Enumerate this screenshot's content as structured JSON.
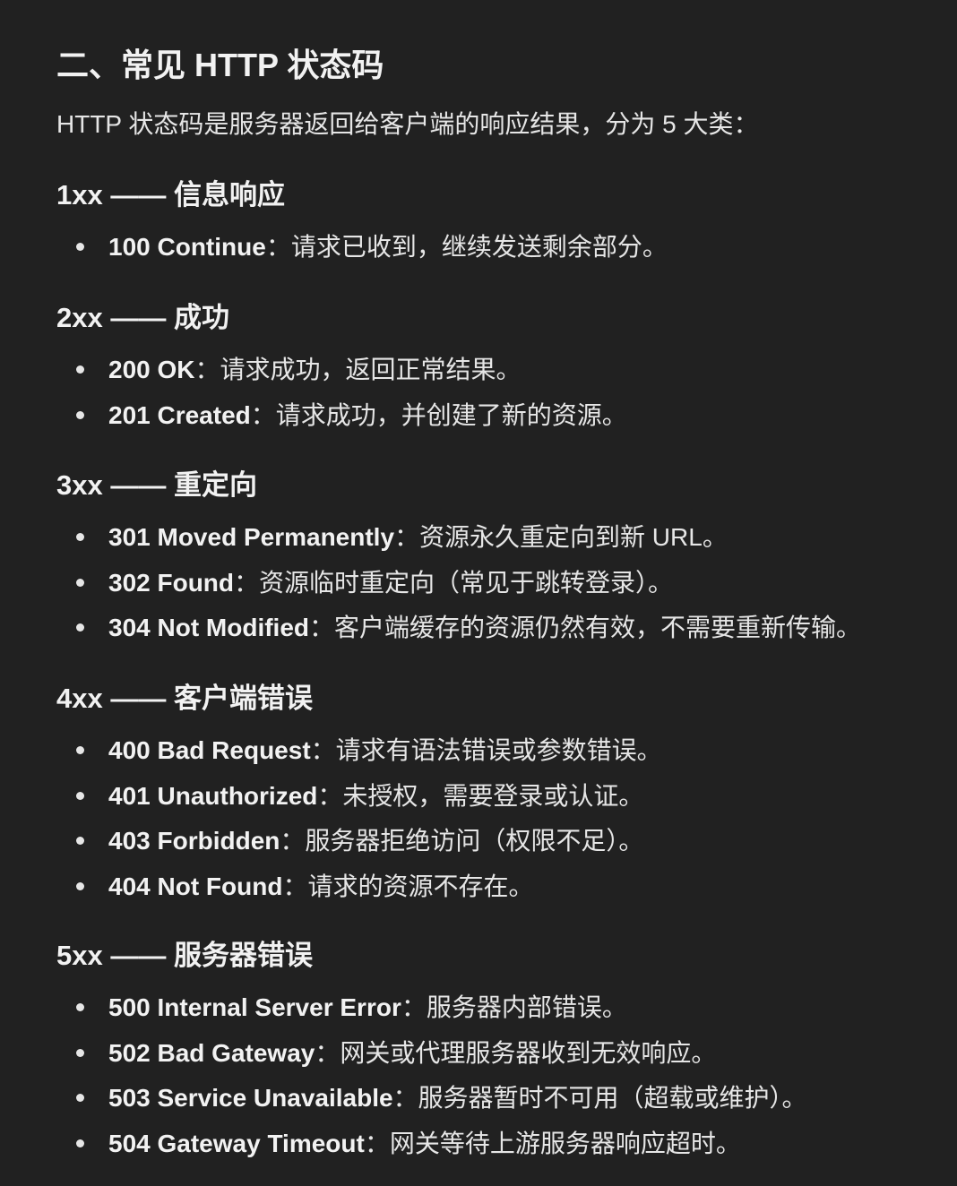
{
  "title": "二、常见 HTTP 状态码",
  "intro": "HTTP 状态码是服务器返回给客户端的响应结果，分为 5 大类：",
  "sections": [
    {
      "heading": "1xx —— 信息响应",
      "items": [
        {
          "code": "100 Continue",
          "desc": "：请求已收到，继续发送剩余部分。"
        }
      ]
    },
    {
      "heading": "2xx —— 成功",
      "items": [
        {
          "code": "200 OK",
          "desc": "：请求成功，返回正常结果。"
        },
        {
          "code": "201 Created",
          "desc": "：请求成功，并创建了新的资源。"
        }
      ]
    },
    {
      "heading": "3xx —— 重定向",
      "items": [
        {
          "code": "301 Moved Permanently",
          "desc": "：资源永久重定向到新 URL。"
        },
        {
          "code": "302 Found",
          "desc": "：资源临时重定向（常见于跳转登录）。"
        },
        {
          "code": "304 Not Modified",
          "desc": "：客户端缓存的资源仍然有效，不需要重新传输。"
        }
      ]
    },
    {
      "heading": "4xx —— 客户端错误",
      "items": [
        {
          "code": "400 Bad Request",
          "desc": "：请求有语法错误或参数错误。"
        },
        {
          "code": "401 Unauthorized",
          "desc": "：未授权，需要登录或认证。"
        },
        {
          "code": "403 Forbidden",
          "desc": "：服务器拒绝访问（权限不足）。"
        },
        {
          "code": "404 Not Found",
          "desc": "：请求的资源不存在。"
        }
      ]
    },
    {
      "heading": "5xx —— 服务器错误",
      "items": [
        {
          "code": "500 Internal Server Error",
          "desc": "：服务器内部错误。"
        },
        {
          "code": "502 Bad Gateway",
          "desc": "：网关或代理服务器收到无效响应。"
        },
        {
          "code": "503 Service Unavailable",
          "desc": "：服务器暂时不可用（超载或维护）。"
        },
        {
          "code": "504 Gateway Timeout",
          "desc": "：网关等待上游服务器响应超时。"
        }
      ]
    }
  ]
}
